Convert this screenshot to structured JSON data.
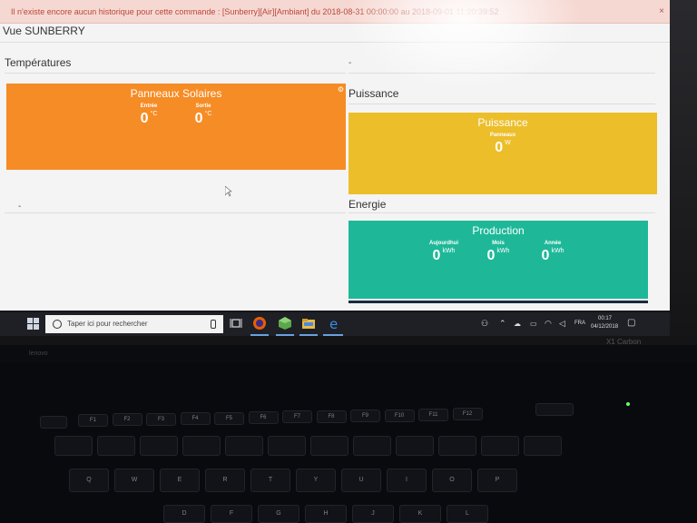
{
  "alert": {
    "text": "Il n'existe encore aucun historique pour cette commande : [Sunberry][Air][Ambiant] du 2018-08-31 00:00:00 au 2018-09-01 11:20:39:52",
    "close_label": "×"
  },
  "page": {
    "title": "Vue SUNBERRY",
    "temperatures_heading": "Températures",
    "puissance_heading": "Puissance",
    "energie_heading": "Energie",
    "dash_left": "-",
    "dash_top_right": "-"
  },
  "tiles": {
    "panneaux": {
      "title": "Panneaux Solaires",
      "color": "#f68c25",
      "metrics": [
        {
          "label": "Entrée",
          "value": "0",
          "unit": "°C"
        },
        {
          "label": "Sortie",
          "value": "0",
          "unit": "°C"
        }
      ]
    },
    "puissance": {
      "title": "Puissance",
      "color": "#ecbe2a",
      "metrics": [
        {
          "label": "Panneaux",
          "value": "0",
          "unit": "W"
        }
      ]
    },
    "production": {
      "title": "Production",
      "color": "#1eb899",
      "metrics": [
        {
          "label": "Aujourdhui",
          "value": "0",
          "unit": "kWh"
        },
        {
          "label": "Mois",
          "value": "0",
          "unit": "kWh"
        },
        {
          "label": "Année",
          "value": "0",
          "unit": "kWh"
        }
      ]
    }
  },
  "taskbar": {
    "search_placeholder": "Taper ici pour rechercher",
    "language": "FRA",
    "time": "00:17",
    "date": "04/12/2018"
  },
  "keyboard": {
    "fkeys": [
      "F1",
      "F2",
      "F3",
      "F4",
      "F5",
      "F6",
      "F7",
      "F8",
      "F9",
      "F10",
      "F11",
      "F12"
    ],
    "letters": [
      "Q",
      "W",
      "E",
      "R",
      "T",
      "Y",
      "U",
      "I",
      "O",
      "P"
    ],
    "bottom_letters": [
      "D",
      "F",
      "G",
      "H",
      "J",
      "K",
      "L"
    ],
    "brand": "lenovo",
    "model": "X1 Carbon"
  }
}
